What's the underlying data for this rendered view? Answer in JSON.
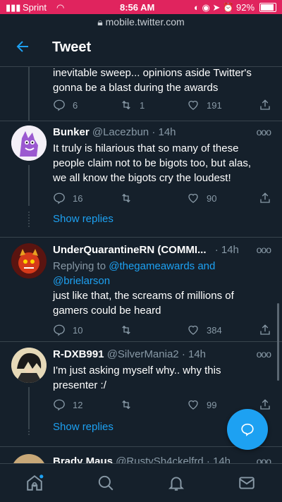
{
  "status_bar": {
    "carrier": "Sprint",
    "time": "8:56 AM",
    "battery": "92%"
  },
  "url_bar": {
    "url": "mobile.twitter.com"
  },
  "header": {
    "title": "Tweet"
  },
  "prev_tweet": {
    "text_line1": "inevitable sweep... opinions aside Twitter's",
    "text_line2": "gonna be a blast during the awards",
    "replies": "6",
    "retweets": "1",
    "likes": "191"
  },
  "tweets": [
    {
      "name": "Bunker",
      "handle": "@Lacezbun",
      "time": "· 14h",
      "text": "It truly is hilarious that so many of these people claim not to be bigots too, but alas, we all know the bigots cry the loudest!",
      "replies": "16",
      "retweets": "",
      "likes": "90"
    },
    {
      "name": "UnderQuarantineRN (COMMI...",
      "handle": "",
      "time": "· 14h",
      "replying_prefix": "Replying to ",
      "replying_to1": "@thegameawards and",
      "replying_to2": "@brielarson",
      "text": "just like that, the screams of millions of gamers could be heard",
      "replies": "10",
      "retweets": "",
      "likes": "384"
    },
    {
      "name": "R-DXB991",
      "handle": "@SilverMania2",
      "time": "· 14h",
      "text": "I'm just asking myself why.. why this presenter :/",
      "replies": "12",
      "retweets": "",
      "likes": "99"
    },
    {
      "name": "Brady Maus",
      "handle": "@RustySh4ckelfrd",
      "time": "· 14h"
    }
  ],
  "show_replies_label": "Show replies",
  "colors": {
    "accent": "#1da1f2",
    "background": "#15202b",
    "status_bar": "#e0245e",
    "divider": "#38444d",
    "muted": "#8899a6"
  },
  "icons": [
    "back-arrow-icon",
    "reply-icon",
    "retweet-icon",
    "like-icon",
    "share-icon",
    "more-icon",
    "compose-reply-icon",
    "home-icon",
    "search-icon",
    "notifications-icon",
    "messages-icon"
  ]
}
